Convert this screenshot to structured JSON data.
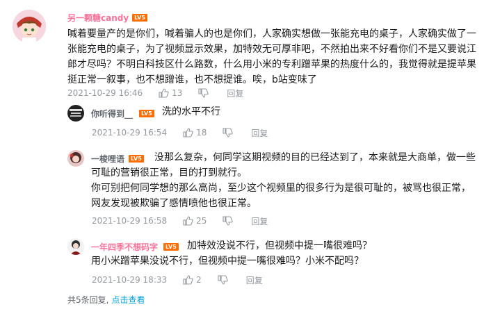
{
  "comment": {
    "username": "另一颗糖candy",
    "level": "LV5",
    "text_lines": [
      "喊着要量产的是你们，喊着骗人的也是你们，人家确实想做一张能充电的桌子，人家确实做了一",
      "张能充电的桌子，为了视频显示效果，加特效无可厚非吧，不然拍出来不好看你们不是又要说江",
      "郎才尽吗？不明白科技区什么路数，什么用小米的专利蹭苹果的热度什么的，我觉得就是提苹果",
      "挺正常一叙事，也不想蹭谁，也不想提谁。唉，b站变味了"
    ],
    "time": "2021-10-29 16:46",
    "likes": "13",
    "reply_label": "回复",
    "colors": {
      "username": "#fb7299",
      "level": "#ff6c00"
    }
  },
  "replies": [
    {
      "username": "你听得到__",
      "level": "LV5",
      "text_lines": [
        "洗的水平不行"
      ],
      "time": "2021-10-29 16:54",
      "likes": "18",
      "reply_label": "回复"
    },
    {
      "username": "一梭哩语",
      "level": "LV5",
      "text_lines": [
        "没那么复杂，何同学这期视频的目的已经达到了，本来就是大商单，做一些",
        "可耻的营销很正常，目的打到就行。",
        "你可别把何同学想的那么高尚，至少这个视频里的很多行为是很可耻的，被骂也很正常，",
        "网友发现被欺骗了感情喷他也很正常。"
      ],
      "time": "2021-10-29 16:58",
      "likes": "25",
      "reply_label": "回复"
    },
    {
      "username": "一年四季不想码字",
      "level": "LV5",
      "text_lines": [
        "加特效没说不行，但视频中提一嘴很难吗？",
        "用小米蹭苹果没说不行，但视频中提一嘴很难吗？小米不配吗？"
      ],
      "time": "2021-10-29 18:33",
      "likes": "2",
      "reply_label": "回复"
    }
  ],
  "footer": {
    "total_text": "共5条回复,",
    "link_text": "点击查看"
  }
}
